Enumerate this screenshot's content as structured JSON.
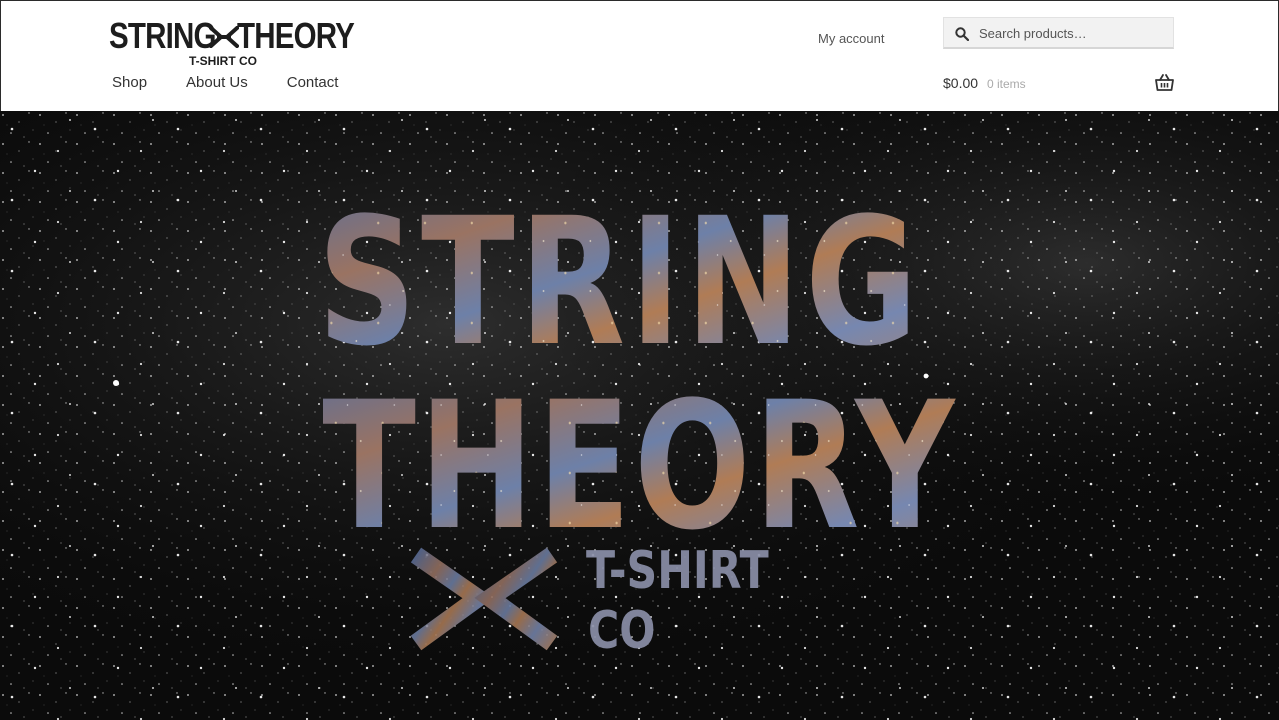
{
  "brand": {
    "word1": "STRING",
    "word2": "THEORY",
    "sub": "T-SHIRT CO"
  },
  "nav": {
    "items": [
      {
        "label": "Shop"
      },
      {
        "label": "About Us"
      },
      {
        "label": "Contact"
      }
    ]
  },
  "account": {
    "label": "My account"
  },
  "search": {
    "placeholder": "Search products…"
  },
  "cart": {
    "amount": "$0.00",
    "count": "0 items"
  },
  "hero": {
    "line1": "STRING",
    "line2": "THEORY",
    "tag1": "T-SHIRT",
    "tag2": "CO"
  },
  "icons": {
    "search": "search-icon",
    "basket": "basket-icon",
    "logo_mark": "string-cross-icon"
  },
  "colors": {
    "header_bg": "#ffffff",
    "text": "#333333",
    "muted": "#aaaaaa",
    "hero_bg": "#0c0c0c"
  }
}
